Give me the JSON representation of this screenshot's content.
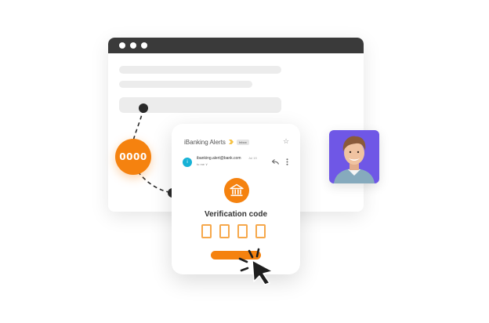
{
  "code_badge": {
    "text": "0000"
  },
  "email": {
    "subject": "iBanking Alerts",
    "label": "Inbox",
    "sender_initial": "i",
    "sender_email": "ibanking.alert@bank.com",
    "date": "Jul 19",
    "to_line": "to me ∨"
  },
  "verification": {
    "title": "Verification code",
    "digit_count": 4
  },
  "colors": {
    "accent": "#f5820f",
    "code_box_border": "#f6a84b",
    "avatar_bg": "#6f57e6",
    "browser_bar": "#3a3a3a",
    "sender_avatar": "#17b2d6"
  },
  "icons": {
    "star": "star-icon",
    "reply": "reply-icon",
    "more": "more-vertical-icon",
    "bank": "bank-icon",
    "cursor": "pointer-cursor-icon"
  }
}
